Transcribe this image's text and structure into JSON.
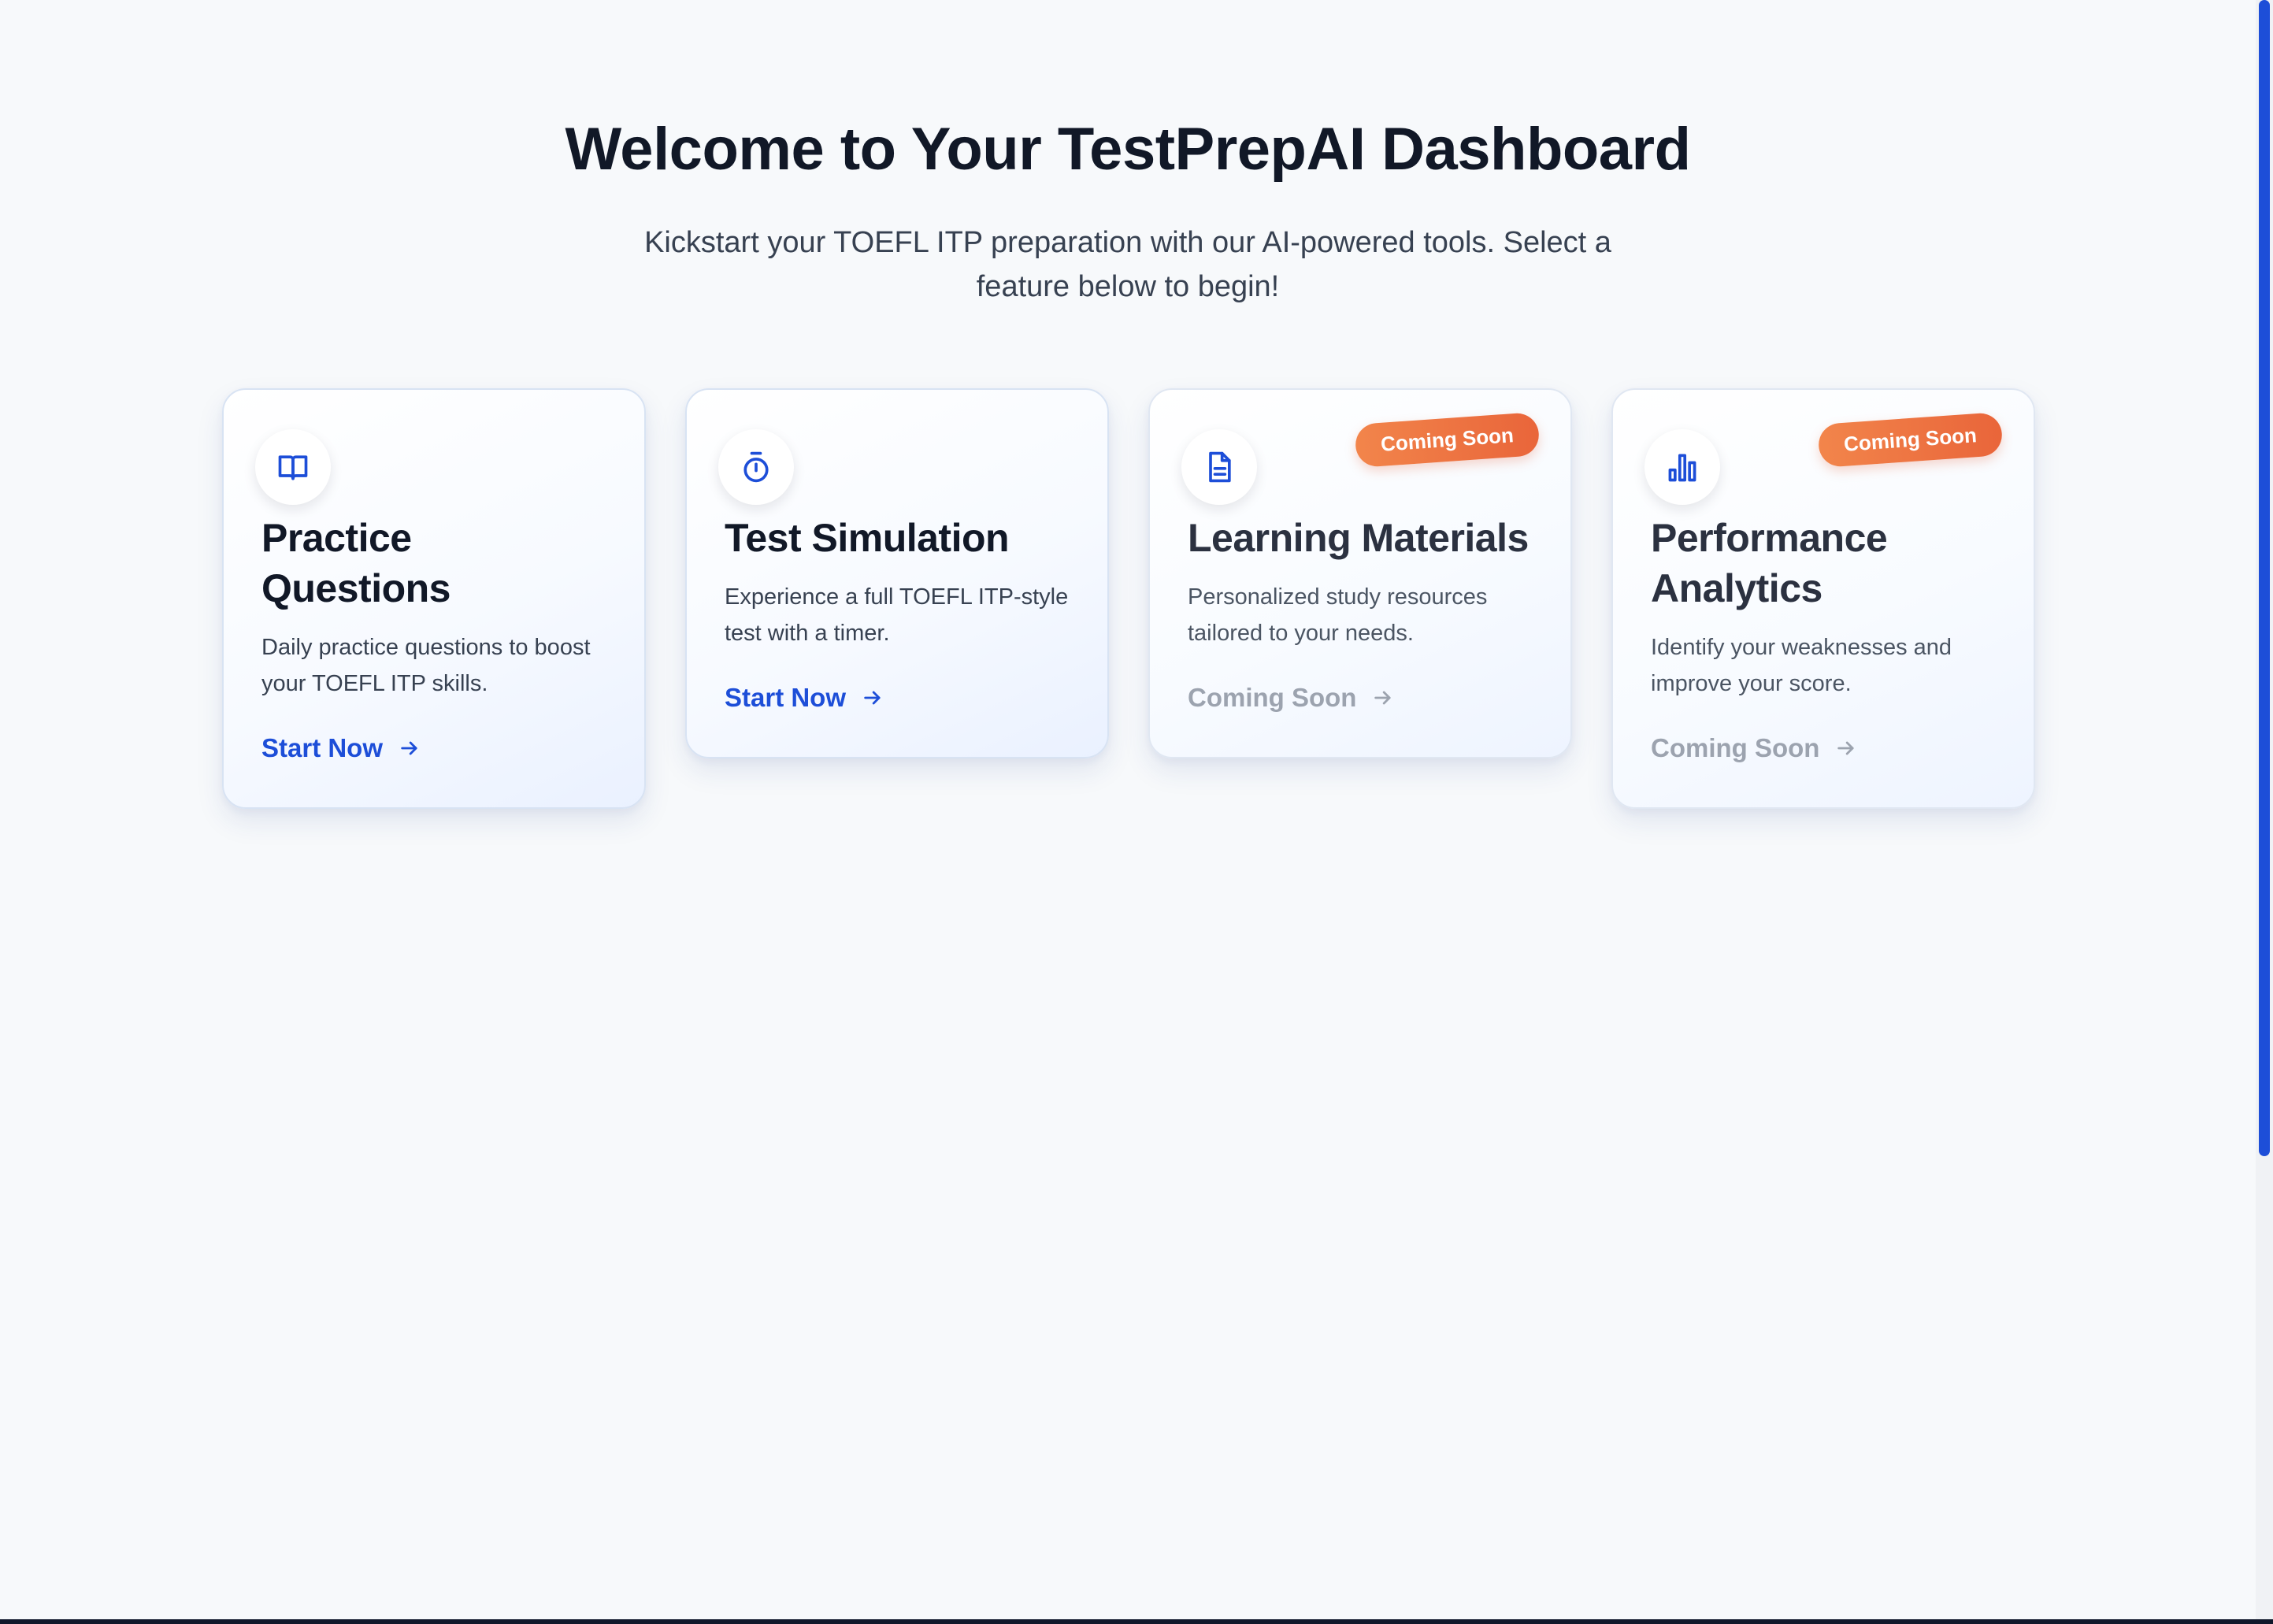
{
  "header": {
    "title": "Welcome to Your TestPrepAI Dashboard",
    "subtitle": "Kickstart your TOEFL ITP preparation with our AI-powered tools. Select a feature below to begin!"
  },
  "cards": [
    {
      "icon": "book-open-icon",
      "title": "Practice Questions",
      "description": "Daily practice questions to boost your TOEFL ITP skills.",
      "action": "Start Now",
      "badge": null
    },
    {
      "icon": "stopwatch-icon",
      "title": "Test Simulation",
      "description": "Experience a full TOEFL ITP-style test with a timer.",
      "action": "Start Now",
      "badge": null
    },
    {
      "icon": "document-icon",
      "title": "Learning Materials",
      "description": "Personalized study resources tailored to your needs.",
      "action": "Coming Soon",
      "badge": "Coming Soon"
    },
    {
      "icon": "bar-chart-icon",
      "title": "Performance Analytics",
      "description": "Identify your weaknesses and improve your score.",
      "action": "Coming Soon",
      "badge": "Coming Soon"
    }
  ],
  "colors": {
    "accent": "#1d4ed8",
    "badge_start": "#f2854b",
    "badge_end": "#e9653a",
    "disabled_text": "#9ca3af",
    "background": "#f7f9fb"
  }
}
